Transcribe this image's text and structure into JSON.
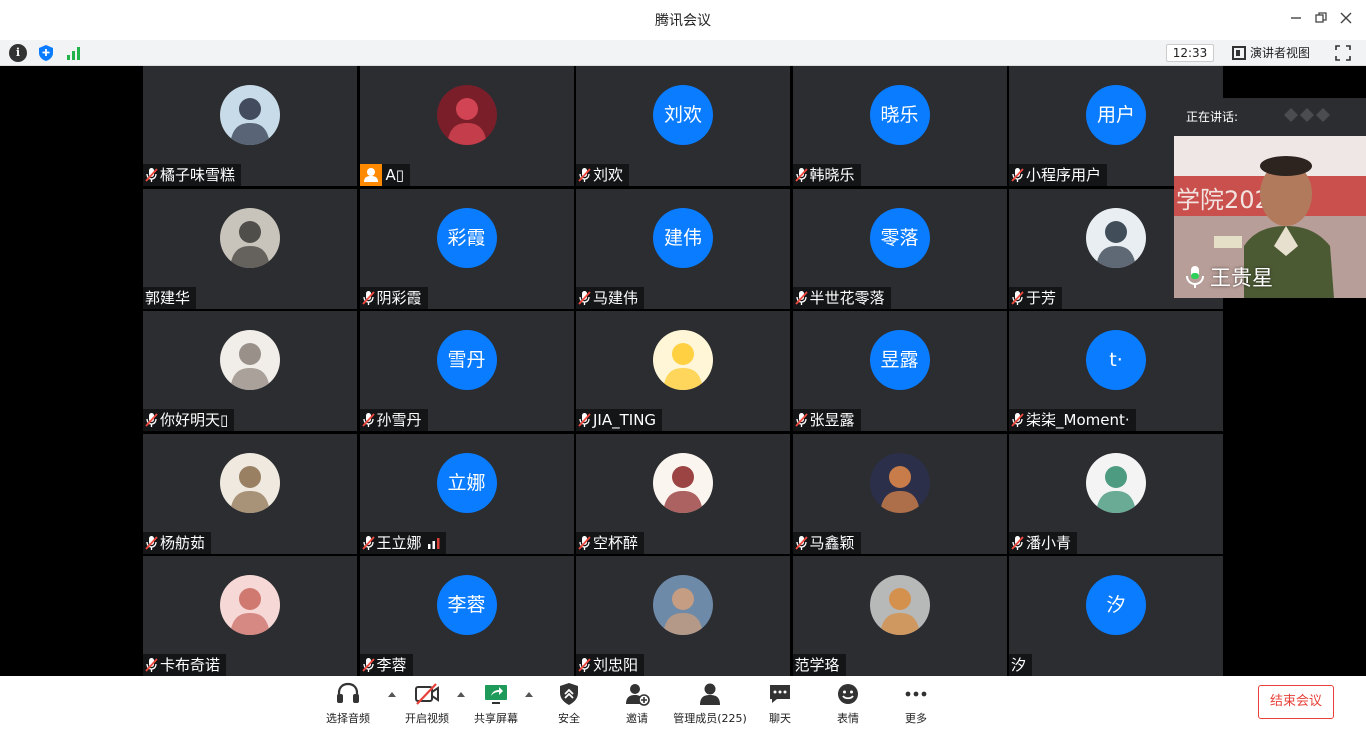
{
  "window": {
    "title": "腾讯会议"
  },
  "infobar": {
    "clock": "12:33",
    "speaker_view_label": "演讲者视图"
  },
  "speaking": {
    "label": "正在讲话:",
    "speaker_name": "王贵星"
  },
  "participants": [
    {
      "name": "橘子味雪糕",
      "avatar_text": "",
      "mic": "muted"
    },
    {
      "name": "A🅰",
      "display": "A▯",
      "avatar_text": "",
      "mic": "none"
    },
    {
      "name": "刘欢",
      "avatar_text": "刘欢",
      "mic": "muted"
    },
    {
      "name": "韩晓乐",
      "avatar_text": "晓乐",
      "mic": "muted"
    },
    {
      "name": "小程序用户",
      "avatar_text": "用户",
      "mic": "muted"
    },
    {
      "name": "郭建华",
      "avatar_text": "",
      "mic": "off"
    },
    {
      "name": "阴彩霞",
      "avatar_text": "彩霞",
      "mic": "muted"
    },
    {
      "name": "马建伟",
      "avatar_text": "建伟",
      "mic": "muted"
    },
    {
      "name": "半世花零落",
      "avatar_text": "零落",
      "mic": "muted"
    },
    {
      "name": "于芳",
      "avatar_text": "",
      "mic": "muted"
    },
    {
      "name": "你好明天▯",
      "avatar_text": "",
      "mic": "muted"
    },
    {
      "name": "孙雪丹",
      "avatar_text": "雪丹",
      "mic": "muted"
    },
    {
      "name": "JIA_TING",
      "avatar_text": "",
      "mic": "muted"
    },
    {
      "name": "张昱露",
      "avatar_text": "昱露",
      "mic": "muted"
    },
    {
      "name": "柒柒_Moment·",
      "avatar_text": "t·",
      "mic": "muted"
    },
    {
      "name": "杨舫茹",
      "avatar_text": "",
      "mic": "muted"
    },
    {
      "name": "王立娜",
      "avatar_text": "立娜",
      "mic": "muted",
      "signal": true
    },
    {
      "name": "空杯醉",
      "avatar_text": "",
      "mic": "muted"
    },
    {
      "name": "马鑫颖",
      "avatar_text": "",
      "mic": "muted"
    },
    {
      "name": "潘小青",
      "avatar_text": "",
      "mic": "muted"
    },
    {
      "name": "卡布奇诺",
      "avatar_text": "",
      "mic": "muted"
    },
    {
      "name": "李蓉",
      "avatar_text": "李蓉",
      "mic": "muted"
    },
    {
      "name": "刘忠阳",
      "avatar_text": "",
      "mic": "muted"
    },
    {
      "name": "范学珞",
      "avatar_text": "",
      "mic": "off"
    },
    {
      "name": "汐",
      "avatar_text": "汐",
      "mic": "off"
    }
  ],
  "toolbar": {
    "audio": "选择音频",
    "video": "开启视频",
    "share": "共享屏幕",
    "security": "安全",
    "invite": "邀请",
    "members": "管理成员(225)",
    "chat": "聊天",
    "reaction": "表情",
    "more": "更多",
    "end": "结束会议"
  },
  "colors": {
    "avatar_blue": "#0a7cff",
    "end_red": "#e8413a",
    "tile_bg": "#2b2d30"
  }
}
